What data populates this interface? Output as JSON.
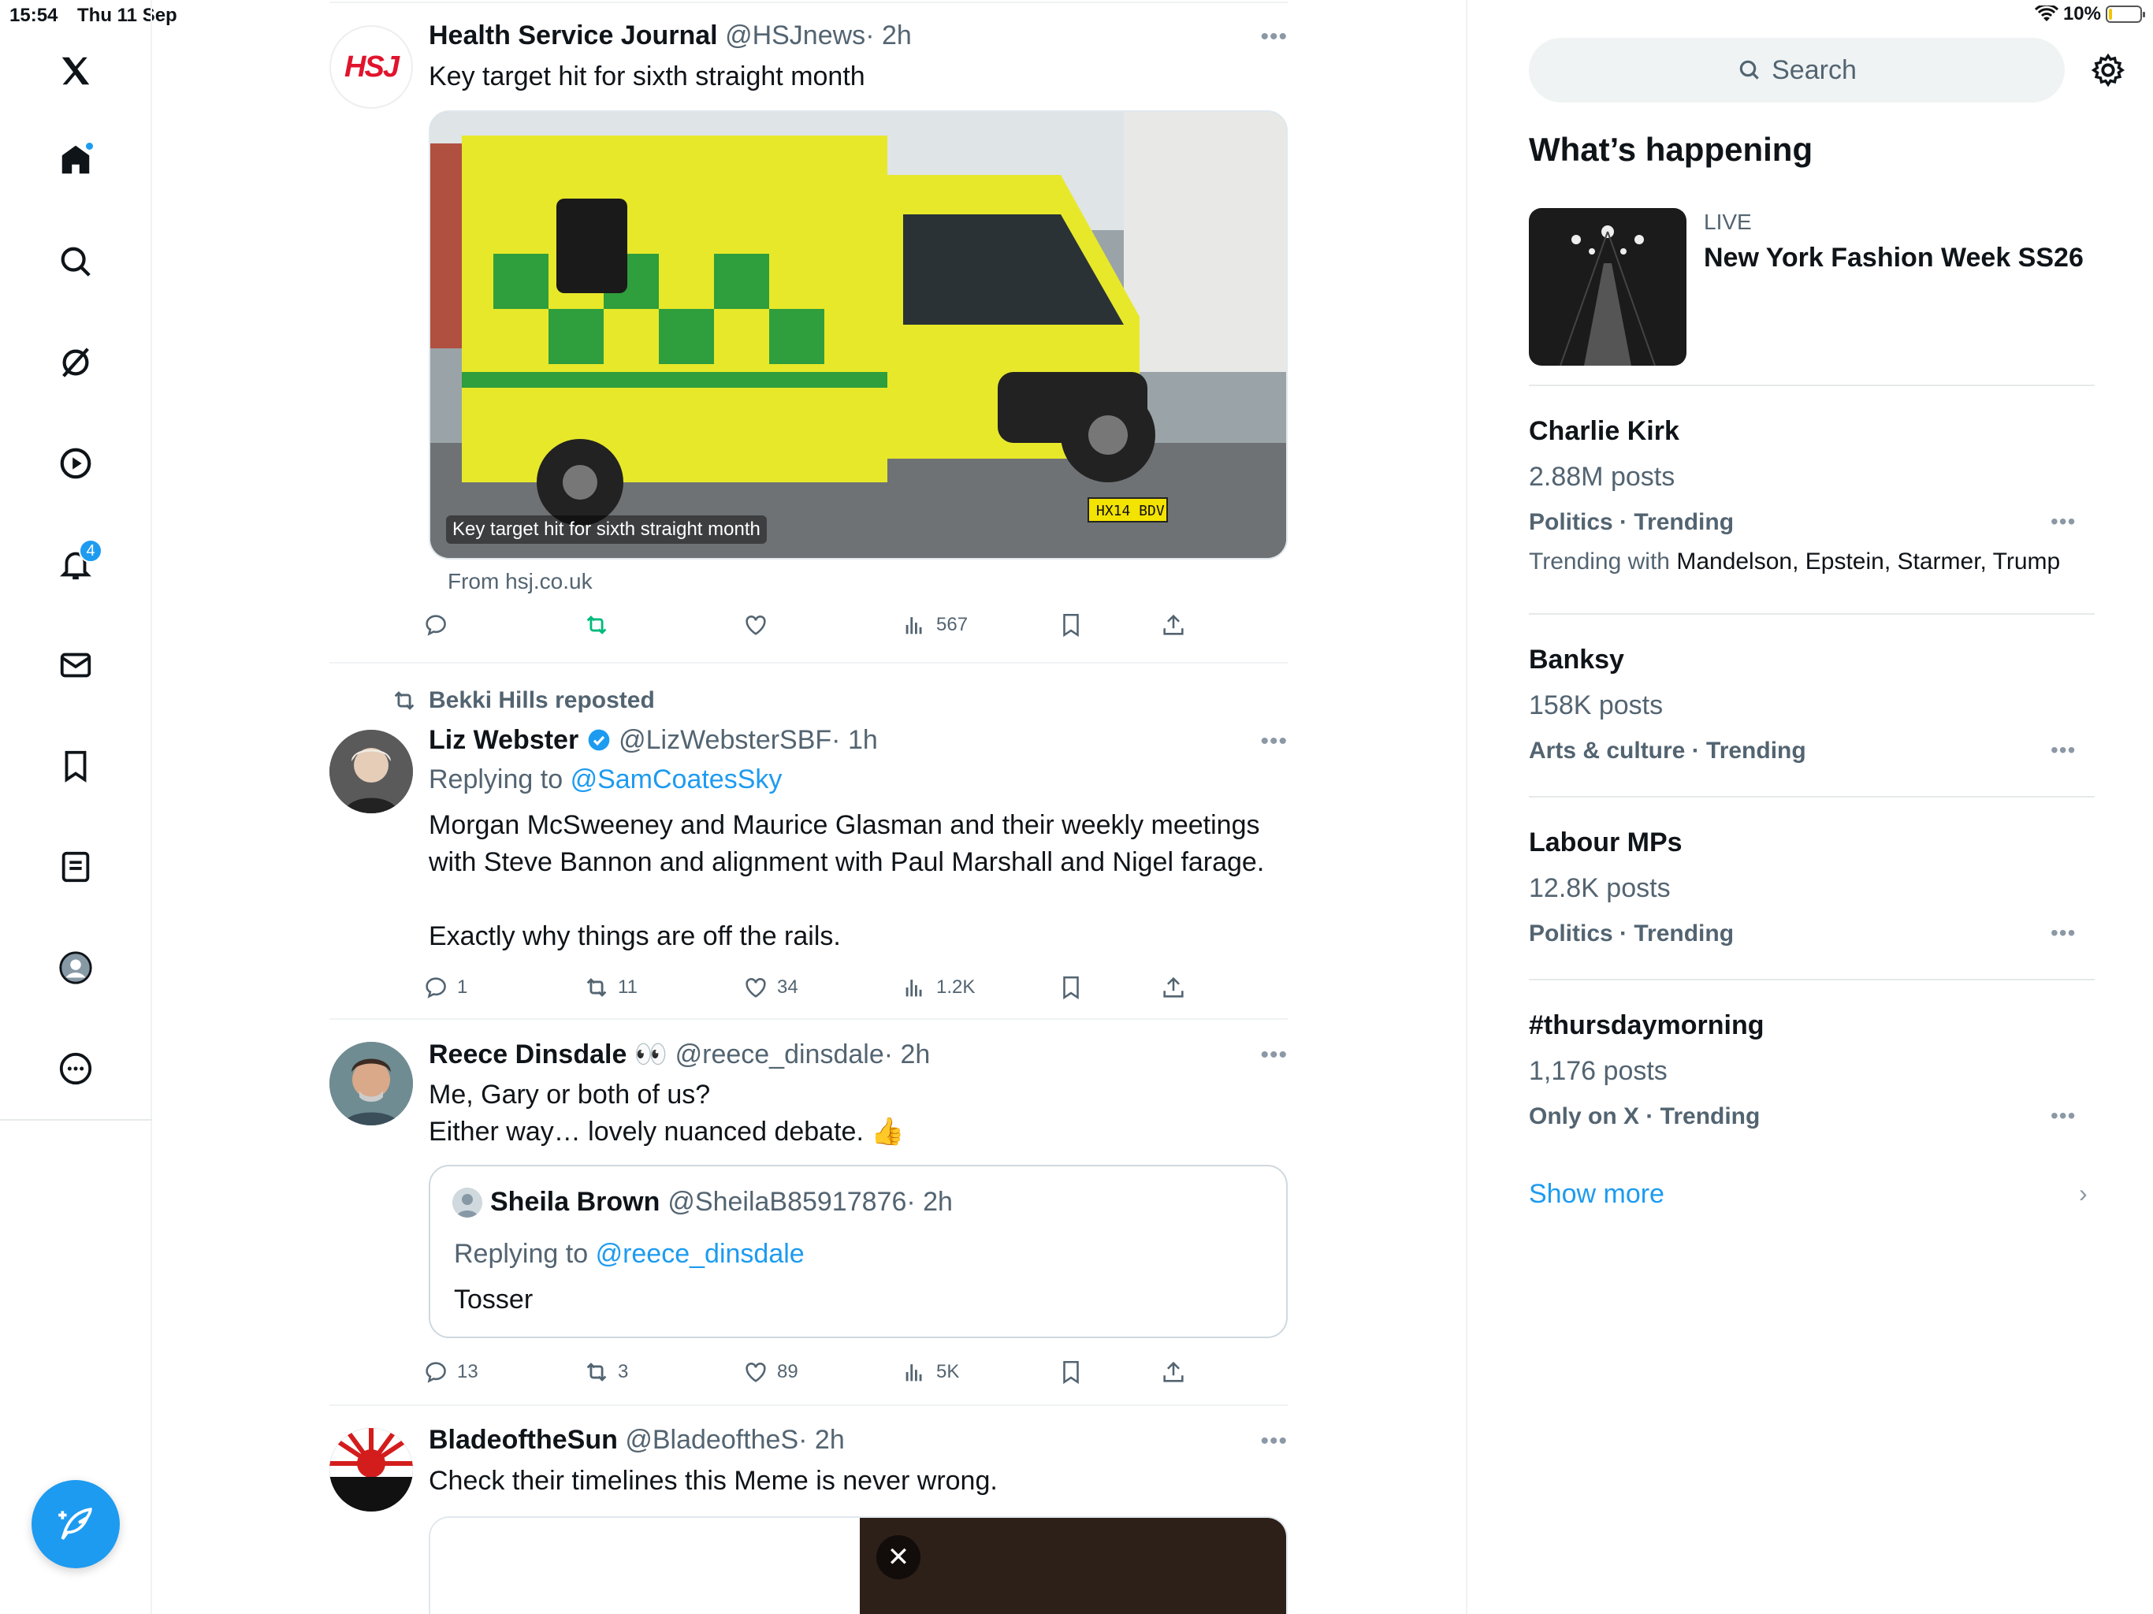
{
  "status_bar": {
    "time": "15:54",
    "date": "Thu 11 Sep",
    "battery": "10%",
    "battery_level": 0.1
  },
  "nav": {
    "notifications_badge": "4",
    "items": [
      "x-logo",
      "home-icon",
      "search-icon",
      "grok-icon",
      "video-icon",
      "bell-icon",
      "mail-icon",
      "bookmark-icon",
      "lists-icon",
      "profile-icon",
      "more-circle-icon"
    ]
  },
  "top_more": "•••",
  "tweets": [
    {
      "name": "Health Service Journal",
      "handle": "@HSJnews",
      "time": "· 2h",
      "text": "Key target hit for sixth straight month",
      "avatar_text": "HSJ",
      "media_caption": "Key target hit for sixth straight month",
      "plate": "HX14 BDV",
      "from": "From hsj.co.uk",
      "views": "567"
    },
    {
      "retweeted_by": "Bekki Hills reposted",
      "name": "Liz Webster",
      "handle": "@LizWebsterSBF",
      "time": "· 1h",
      "replying_prefix": "Replying to",
      "replying_to": "@SamCoatesSky",
      "text": "Morgan McSweeney and Maurice Glasman and their weekly meetings\nwith Steve Bannon and alignment with Paul Marshall and Nigel farage.\n\nExactly why things are off the rails.",
      "replies": "1",
      "retweets": "11",
      "likes": "34",
      "views": "1.2K"
    },
    {
      "name": "Reece Dinsdale",
      "name_emoji": "👀",
      "handle": "@reece_dinsdale",
      "time": "· 2h",
      "text": "Me, Gary or both of us?\nEither way… lovely nuanced debate. 👍",
      "quote": {
        "name": "Sheila Brown",
        "handle": "@SheilaB85917876",
        "time": "· 2h",
        "replying_prefix": "Replying to",
        "replying_to": "@reece_dinsdale",
        "text": "Tosser"
      },
      "replies": "13",
      "retweets": "3",
      "likes": "89",
      "views": "5K"
    },
    {
      "name": "BladeoftheSun",
      "handle": "@BladeoftheS",
      "time": "· 2h",
      "text": "Check their timelines this Meme is never wrong.",
      "close_label": "✕"
    }
  ],
  "right": {
    "search_placeholder": "Search",
    "whats_happening": "What’s happening",
    "live": {
      "tag": "LIVE",
      "title": "New York Fashion Week SS26"
    },
    "trends": [
      {
        "name": "Charlie Kirk",
        "count": "2.88M posts",
        "category": "Politics · Trending",
        "with_label": "Trending with",
        "with": "Mandelson, Epstein, Starmer, Trump"
      },
      {
        "name": "Banksy",
        "count": "158K posts",
        "category": "Arts & culture · Trending"
      },
      {
        "name": "Labour MPs",
        "count": "12.8K posts",
        "category": "Politics · Trending"
      },
      {
        "name": "#thursdaymorning",
        "count": "1,176 posts",
        "category": "Only on X · Trending"
      }
    ],
    "show_more": "Show more"
  },
  "colors": {
    "accent": "#1d9bf0",
    "text": "#0f1419",
    "muted": "#536471",
    "retweet_green": "#00ba7c"
  }
}
